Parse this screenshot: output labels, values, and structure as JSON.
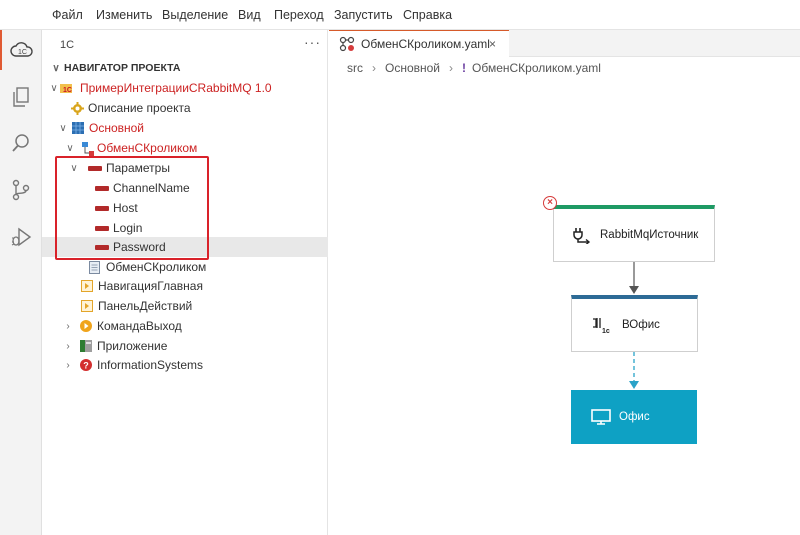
{
  "menu": {
    "items": [
      "Файл",
      "Изменить",
      "Выделение",
      "Вид",
      "Переход",
      "Запустить",
      "Справка"
    ]
  },
  "sidebar": {
    "header": "1С",
    "more": "···",
    "section_title": "НАВИГАТОР ПРОЕКТА",
    "tree": {
      "project": "ПримерИнтеграцииCRabbitMQ 1.0",
      "project_description": "Описание проекта",
      "subsystem": "Основной",
      "exchange": "ОбменСКроликом",
      "parameters": "Параметры",
      "params": [
        "ChannelName",
        "Host",
        "Login",
        "Password"
      ],
      "exchange_file": "ОбменСКроликом",
      "nav_main": "НавигацияГлавная",
      "actions_panel": "ПанельДействий",
      "command_exit": "КомандаВыход",
      "application": "Приложение",
      "information_systems": "InformationSystems"
    }
  },
  "editor": {
    "tab_label": "ОбменСКроликом.yaml",
    "tab_close": "×",
    "breadcrumb": {
      "src": "src",
      "folder": "Основной",
      "bang": "!",
      "file": "ОбменСКроликом.yaml"
    },
    "diagram": {
      "source_node": "RabbitMqИсточник",
      "transform_node": "ВОфис",
      "target_node": "Офис",
      "error_mark": "×",
      "colors": {
        "source_bar": "#1e9a64",
        "transform_bar": "#2d6b96",
        "target_fill": "#0ea1c4",
        "error": "#d63b3b"
      }
    }
  }
}
